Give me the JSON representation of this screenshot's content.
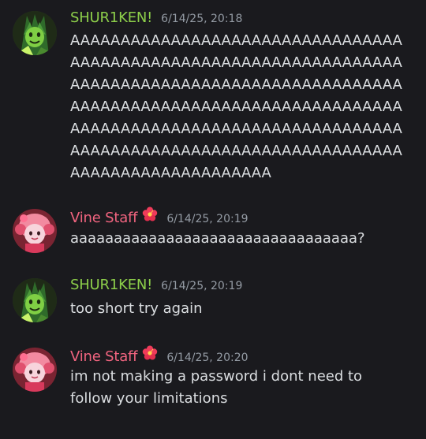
{
  "colors": {
    "background": "#1a1a1e",
    "shuriken_name": "#8dcf4a",
    "vine_name": "#f0647f",
    "timestamp": "#949ba4",
    "text": "#dbdee1"
  },
  "messages": [
    {
      "username": "SHUR1KEN!",
      "badge_icon": "",
      "timestamp": "6/14/25, 20:18",
      "text": "AAAAAAAAAAAAAAAAAAAAAAAAAAAAAAAAAAAAAAAAAAAAAAAAAAAAAAAAAAAAAAAAAAAAAAAAAAAAAAAAAAAAAAAAAAAAAAAAAAAAAAAAAAAAAAAAAAAAAAAAAAAAAAAAAAAAAAAAAAAAAAAAAAAAAAAAAAAAAAAAAAAAAAAAAAAAAAAAAAAAAAAAAAAAAAAAAAAAAAAAAAAAAAAAAAAAAAAAAA",
      "avatar_icon": "green-character-avatar-icon"
    },
    {
      "username": "Vine Staff",
      "badge_icon": "hibiscus-flower-icon",
      "timestamp": "6/14/25, 20:19",
      "text": "aaaaaaaaaaaaaaaaaaaaaaaaaaaaaaaaa?",
      "avatar_icon": "pink-character-avatar-icon"
    },
    {
      "username": "SHUR1KEN!",
      "badge_icon": "",
      "timestamp": "6/14/25, 20:19",
      "text": "too short try again",
      "avatar_icon": "green-character-avatar-icon"
    },
    {
      "username": "Vine Staff",
      "badge_icon": "hibiscus-flower-icon",
      "timestamp": "6/14/25, 20:20",
      "text": "im not making a password i dont need to follow your limitations",
      "avatar_icon": "pink-character-avatar-icon"
    }
  ]
}
